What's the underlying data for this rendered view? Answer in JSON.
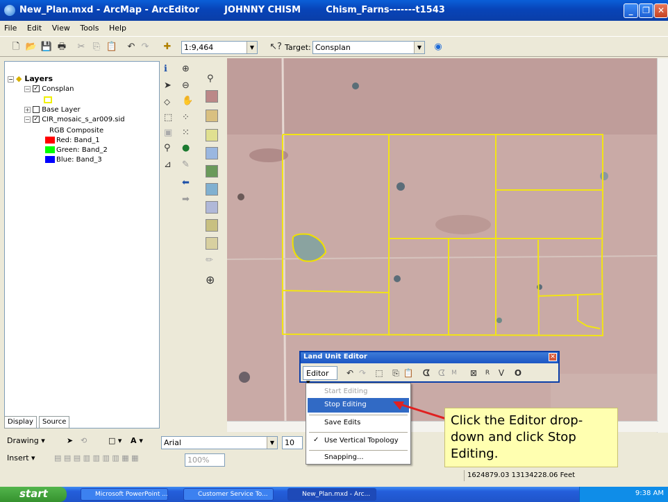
{
  "window": {
    "title": "New_Plan.mxd - ArcMap - ArcEditor        JOHNNY CHISM        Chism_Farns-------t1543",
    "controls": [
      "_",
      "❐",
      "✕"
    ]
  },
  "menu": [
    "File",
    "Edit",
    "View",
    "Tools",
    "Help"
  ],
  "toolbar": {
    "scale": "1:9,464",
    "target_label": "Target:",
    "target_value": "Consplan"
  },
  "toc": {
    "root": "Layers",
    "layers": [
      {
        "name": "Consplan",
        "checked": true
      },
      {
        "name": "Base Layer",
        "checked": false
      },
      {
        "name": "CIR_mosaic_s_ar009.sid",
        "checked": true
      }
    ],
    "rgb_label": "RGB Composite",
    "bands": [
      {
        "label": "Red:   Band_1",
        "color": "#ff0000"
      },
      {
        "label": "Green: Band_2",
        "color": "#00ff00"
      },
      {
        "label": "Blue:  Band_3",
        "color": "#0000ff"
      }
    ],
    "tabs": [
      "Display",
      "Source"
    ]
  },
  "drawing": {
    "label": "Drawing ▾",
    "font": "Arial",
    "size": "10"
  },
  "insert": {
    "label": "Insert ▾",
    "zoom": "100%"
  },
  "status": "1624879.03  13134228.06 Feet",
  "editor": {
    "title": "Land Unit Editor",
    "editor_button": "Editor ▾",
    "menu_items": [
      {
        "label": "Start Editing",
        "state": "disabled"
      },
      {
        "label": "Stop Editing",
        "state": "selected"
      },
      {
        "label": "Save Edits",
        "state": "normal"
      },
      {
        "label": "Use Vertical Topology",
        "state": "checked"
      },
      {
        "label": "Snapping...",
        "state": "normal"
      }
    ]
  },
  "callout": "Click the Editor drop-down and click Stop Editing.",
  "taskbar": {
    "start": "start",
    "tasks": [
      "Microsoft PowerPoint ...",
      "Customer Service To...",
      "New_Plan.mxd - Arc..."
    ],
    "clock": "9:38 AM"
  }
}
